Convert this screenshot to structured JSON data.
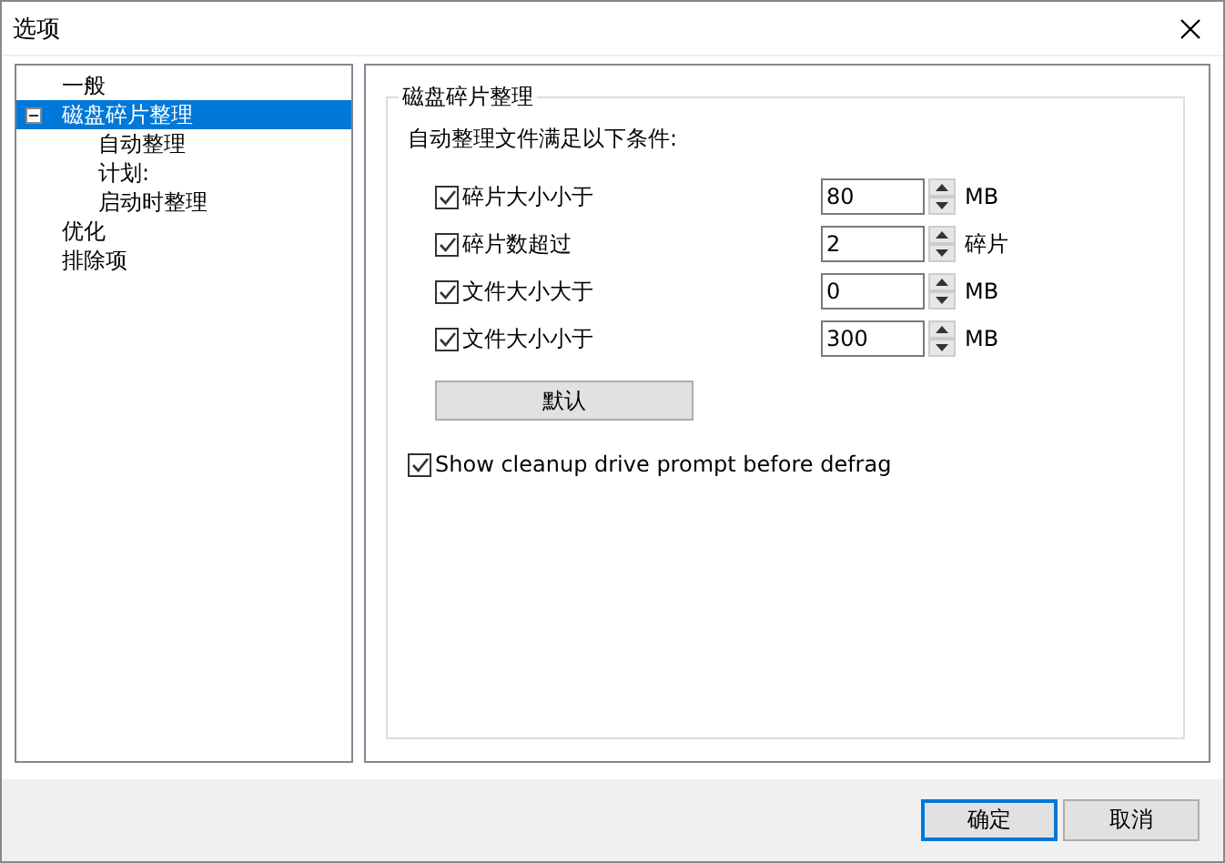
{
  "window": {
    "title": "选项"
  },
  "tree": [
    {
      "label": "一般",
      "selected": false
    },
    {
      "label": "磁盘碎片整理",
      "selected": true,
      "expanded": true,
      "children": [
        {
          "label": "自动整理",
          "selected": false
        },
        {
          "label": "计划:",
          "selected": false
        },
        {
          "label": "启动时整理",
          "selected": false
        }
      ]
    },
    {
      "label": "优化",
      "selected": false
    },
    {
      "label": "排除项",
      "selected": false
    }
  ],
  "group": {
    "title": "磁盘碎片整理",
    "subtitle": "自动整理文件满足以下条件:",
    "conditions": [
      {
        "label": "碎片大小小于",
        "checked": true,
        "value": "80",
        "unit": "MB"
      },
      {
        "label": "碎片数超过",
        "checked": true,
        "value": "2",
        "unit": "碎片"
      },
      {
        "label": "文件大小大于",
        "checked": true,
        "value": "0",
        "unit": "MB"
      },
      {
        "label": "文件大小小于",
        "checked": true,
        "value": "300",
        "unit": "MB"
      }
    ],
    "default_button": "默认",
    "prompt": {
      "label": "Show cleanup drive prompt before defrag",
      "checked": true
    }
  },
  "buttons": [
    {
      "label": "确定",
      "selected": true
    },
    {
      "label": "取消",
      "selected": false
    }
  ]
}
